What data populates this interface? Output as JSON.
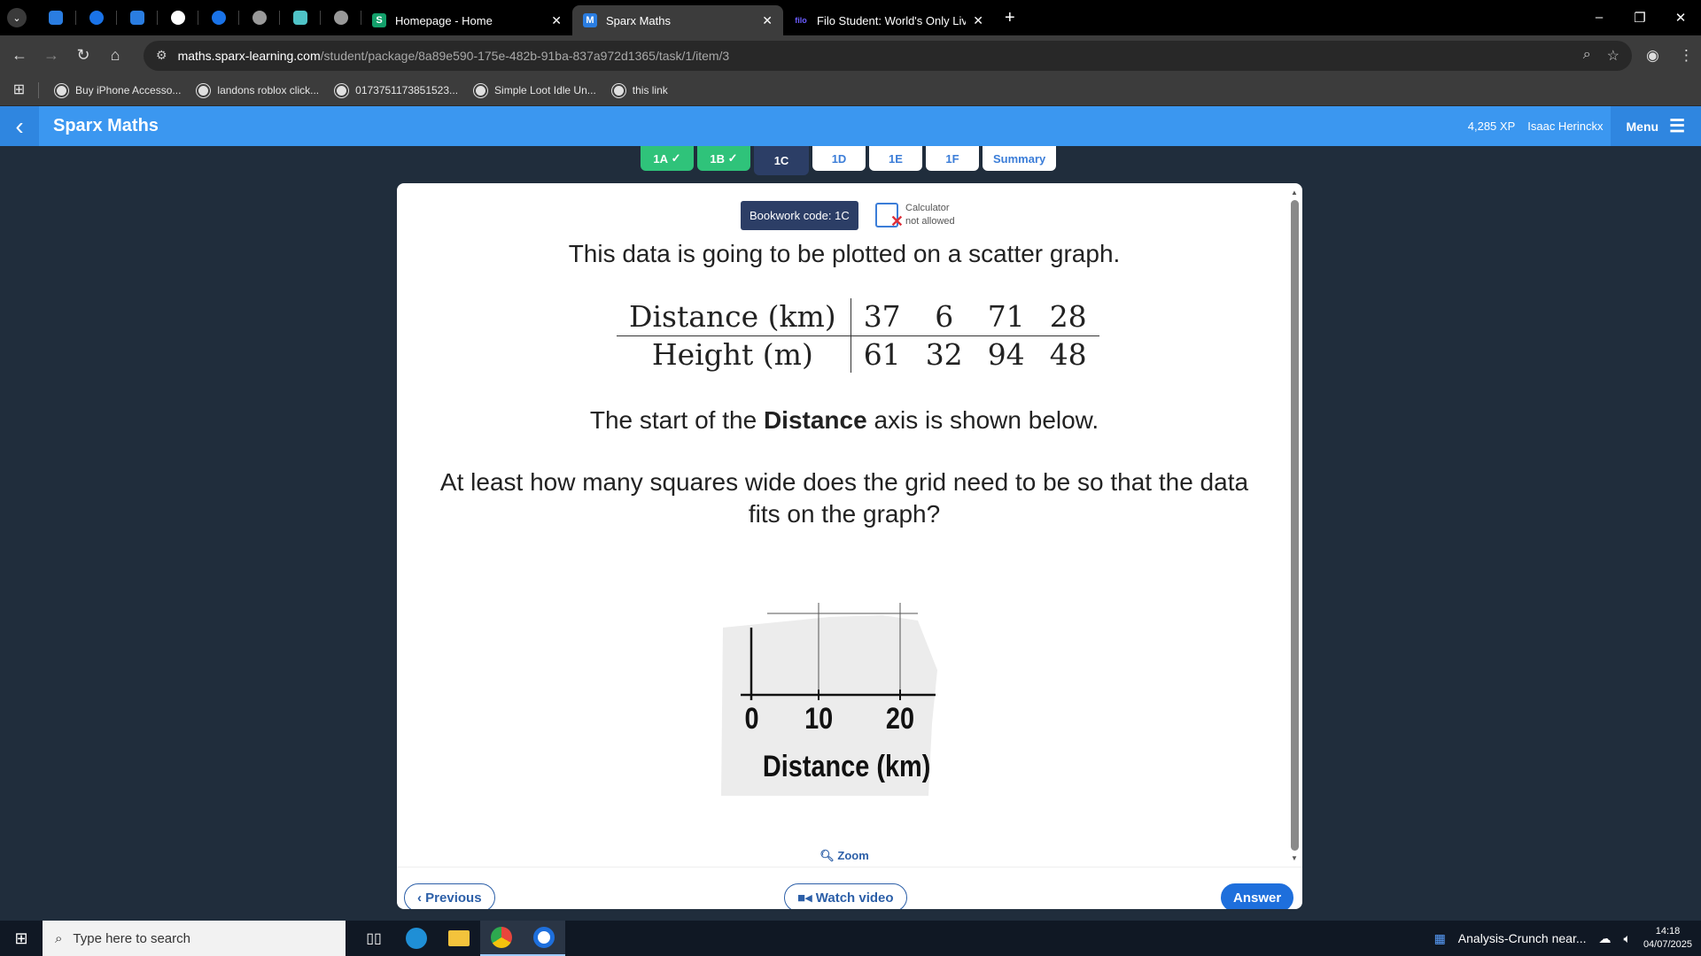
{
  "browser": {
    "tabs": [
      {
        "title": "Homepage - Home",
        "active": false
      },
      {
        "title": "Sparx Maths",
        "active": true
      },
      {
        "title": "Filo Student: World's Only Live",
        "active": false
      }
    ],
    "url_domain": "maths.sparx-learning.com",
    "url_path": "/student/package/8a89e590-175e-482b-91ba-837a972d1365/task/1/item/3",
    "bookmarks": [
      "Buy iPhone Accesso...",
      "landons roblox click...",
      "0173751173851523...",
      "Simple Loot Idle Un...",
      "this link"
    ]
  },
  "app": {
    "title": "Sparx Maths",
    "xp": "4,285 XP",
    "user": "Isaac Herinckx",
    "menu_label": "Menu"
  },
  "subtabs": [
    {
      "label": "1A",
      "state": "done"
    },
    {
      "label": "1B",
      "state": "done"
    },
    {
      "label": "1C",
      "state": "current"
    },
    {
      "label": "1D",
      "state": "todo"
    },
    {
      "label": "1E",
      "state": "todo"
    },
    {
      "label": "1F",
      "state": "todo"
    },
    {
      "label": "Summary",
      "state": "todo"
    }
  ],
  "question": {
    "bookwork": "Bookwork code: 1C",
    "calculator_line1": "Calculator",
    "calculator_line2": "not allowed",
    "intro": "This data is going to be plotted on a scatter graph.",
    "table": {
      "row1_label": "Distance (km)",
      "row1_values": [
        "37",
        "6",
        "71",
        "28"
      ],
      "row2_label": "Height (m)",
      "row2_values": [
        "61",
        "32",
        "94",
        "48"
      ]
    },
    "axis_intro_a": "The start of the ",
    "axis_intro_bold": "Distance",
    "axis_intro_b": " axis is shown below.",
    "prompt": "At least how many squares wide does the grid need to be so that the data fits on the graph?",
    "graph": {
      "tick_labels": [
        "0",
        "10",
        "20"
      ],
      "axis_label": "Distance (km)"
    },
    "zoom_label": "Zoom"
  },
  "footer": {
    "previous": "Previous",
    "watch_video": "Watch video",
    "answer": "Answer"
  },
  "taskbar": {
    "search_placeholder": "Type here to search",
    "notification": "Analysis-Crunch near...",
    "time": "14:18",
    "date": "04/07/2025"
  }
}
